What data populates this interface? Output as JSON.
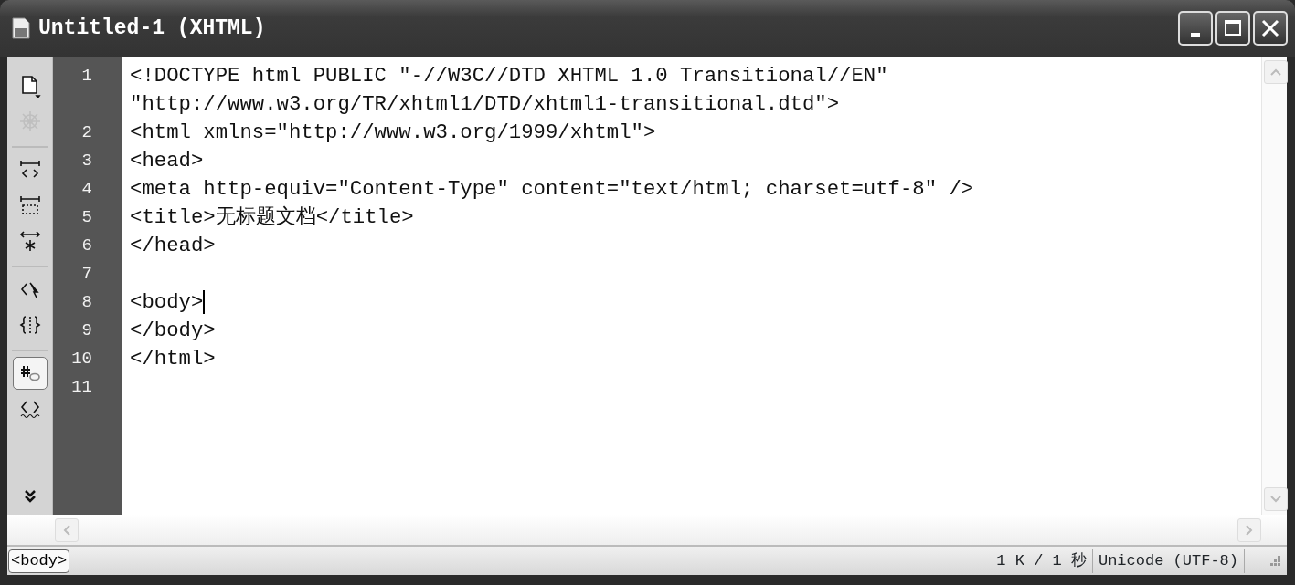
{
  "window": {
    "title": "Untitled-1 (XHTML)"
  },
  "toolbar_groups": [
    [
      {
        "kind": "file",
        "disabled": false,
        "pressed": false
      },
      {
        "kind": "wheel",
        "disabled": true,
        "pressed": false
      }
    ],
    [
      {
        "kind": "collapse-tag",
        "disabled": false,
        "pressed": false
      },
      {
        "kind": "collapse-selection",
        "disabled": false,
        "pressed": false
      },
      {
        "kind": "expand-all",
        "disabled": false,
        "pressed": false
      }
    ],
    [
      {
        "kind": "select-parent",
        "disabled": false,
        "pressed": false
      },
      {
        "kind": "braces",
        "disabled": false,
        "pressed": false
      }
    ],
    [
      {
        "kind": "line-numbers",
        "disabled": false,
        "pressed": true
      },
      {
        "kind": "invalid-code",
        "disabled": false,
        "pressed": false
      },
      {
        "kind": "more",
        "disabled": false,
        "pressed": false
      }
    ]
  ],
  "lines": [
    {
      "number": "1",
      "text": "<!DOCTYPE html PUBLIC \"-//W3C//DTD XHTML 1.0 Transitional//EN\" \"http://www.w3.org/TR/xhtml1/DTD/xhtml1-transitional.dtd\">",
      "caret": false
    },
    {
      "number": "2",
      "text": "<html xmlns=\"http://www.w3.org/1999/xhtml\">",
      "caret": false
    },
    {
      "number": "3",
      "text": "<head>",
      "caret": false
    },
    {
      "number": "4",
      "text": "<meta http-equiv=\"Content-Type\" content=\"text/html; charset=utf-8\" />",
      "caret": false
    },
    {
      "number": "5",
      "text": "<title>无标题文档</title>",
      "caret": false
    },
    {
      "number": "6",
      "text": "</head>",
      "caret": false
    },
    {
      "number": "7",
      "caret": false
    },
    {
      "number": "8",
      "text": "<body>",
      "caret": true
    },
    {
      "number": "9",
      "text": "</body>",
      "caret": false
    },
    {
      "number": "10",
      "text": "</html>",
      "caret": false
    },
    {
      "number": "11",
      "caret": false
    }
  ],
  "status_bar": {
    "tag": "<body>",
    "download": "1 K / 1 秒",
    "encoding": "Unicode (UTF-8)"
  }
}
